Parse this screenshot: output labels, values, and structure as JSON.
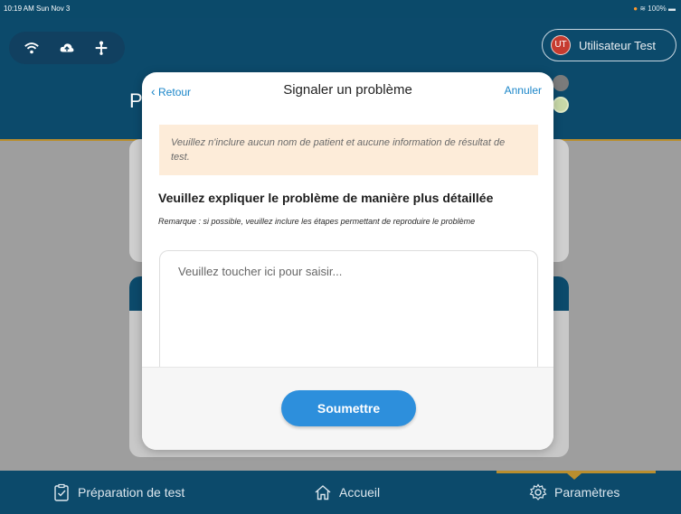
{
  "status_bar": {
    "time_date": "10:19 AM  Sun Nov 3",
    "battery": "100%"
  },
  "header": {
    "user": {
      "initials": "UT",
      "name": "Utilisateur Test"
    },
    "page_title": "P"
  },
  "modal": {
    "back_label": "Retour",
    "title": "Signaler un problème",
    "cancel_label": "Annuler",
    "warning": "Veuillez n'inclure aucun nom de patient et aucune information de résultat de test.",
    "field_label": "Veuillez expliquer le problème de manière plus détaillée",
    "note": "Remarque : si possible, veuillez inclure les étapes permettant de reproduire le problème",
    "input_placeholder": "Veuillez toucher ici pour saisir...",
    "submit_label": "Soumettre"
  },
  "tabs": [
    {
      "label": "Préparation de test",
      "icon": "clipboard-check-icon"
    },
    {
      "label": "Accueil",
      "icon": "home-icon"
    },
    {
      "label": "Paramètres",
      "icon": "gear-icon",
      "active": true
    }
  ],
  "colors": {
    "header": "#0c4a6b",
    "accent": "#b98e2f",
    "link": "#1b86c9",
    "button": "#2d8fdc",
    "warning_bg": "#fdecd9"
  }
}
